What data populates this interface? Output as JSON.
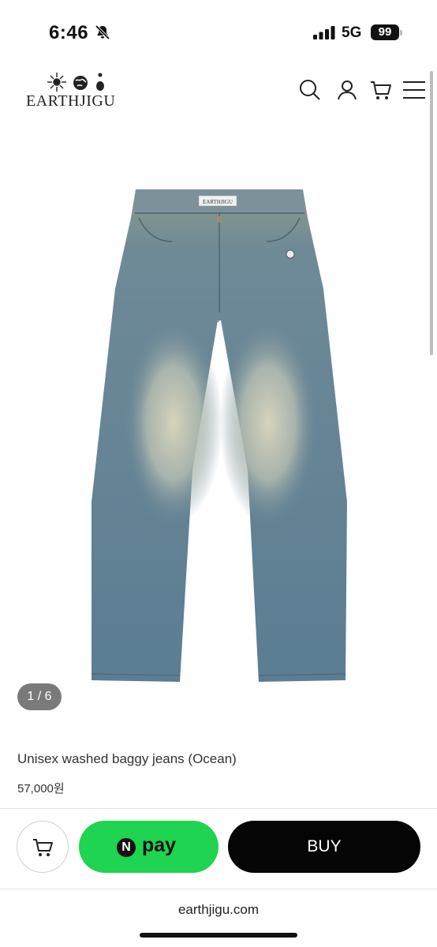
{
  "status_bar": {
    "time": "6:46",
    "network": "5G",
    "battery": "99"
  },
  "header": {
    "logo_text": "EARTHJIGU",
    "icons": [
      "search-icon",
      "user-icon",
      "cart-icon",
      "menu-icon"
    ]
  },
  "product": {
    "image_label": "EARTHJIGU",
    "pager": "1 / 6",
    "title": "Unisex washed baggy jeans (Ocean)",
    "price": "57,000원"
  },
  "actions": {
    "cart_icon": "cart-icon",
    "npay_badge": "N",
    "npay_label": "pay",
    "buy_label": "BUY",
    "colors": {
      "npay": "#1ed450",
      "buy": "#050505"
    }
  },
  "footer": {
    "domain": "earthjigu.com"
  }
}
